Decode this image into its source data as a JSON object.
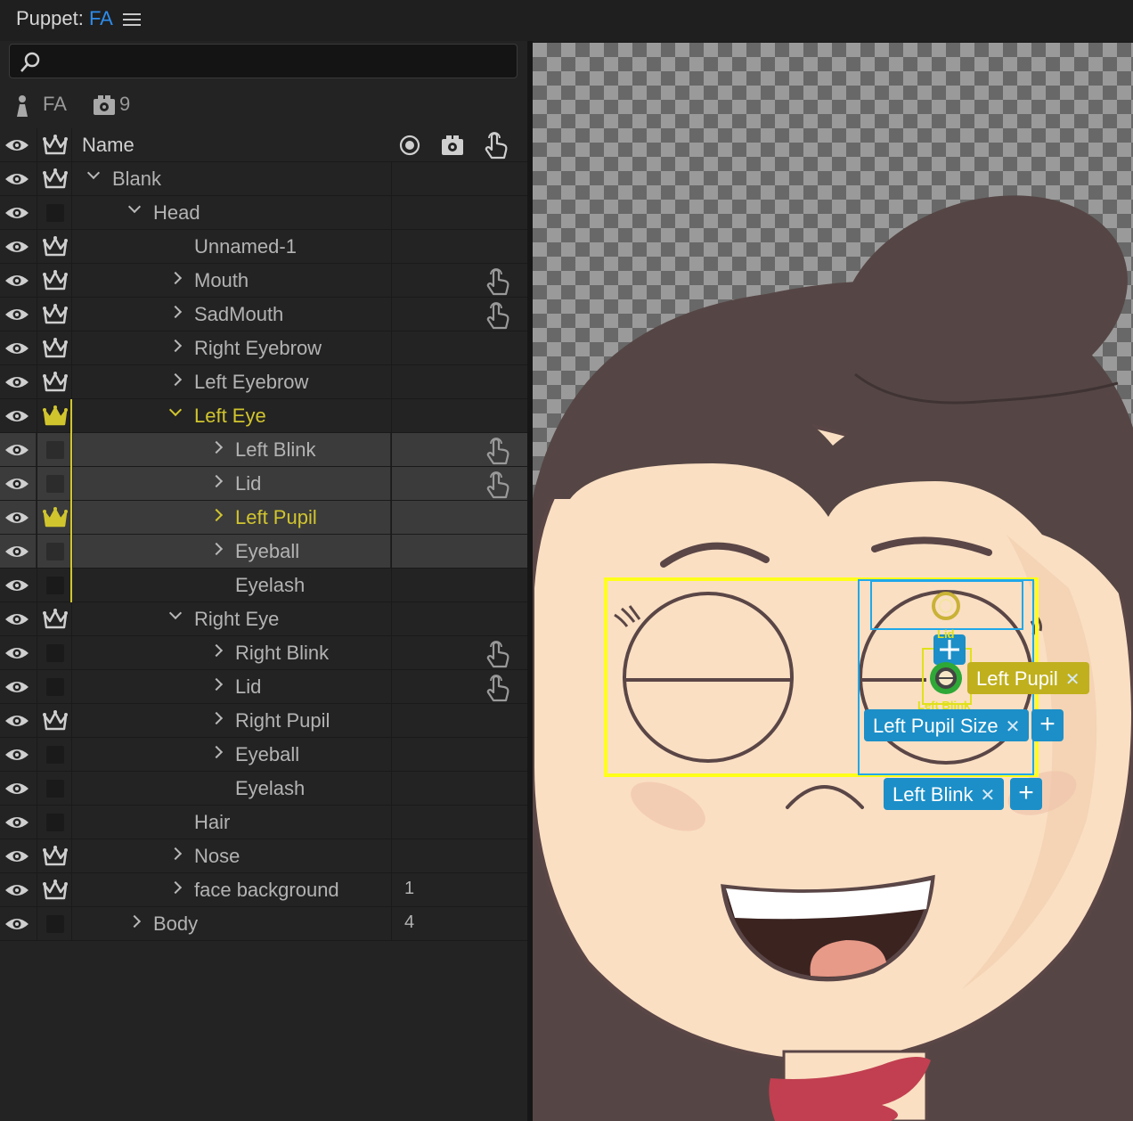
{
  "header": {
    "title_prefix": "Puppet: ",
    "title_accent": "FA",
    "menu_icon": "hamburger-menu-icon"
  },
  "search": {
    "placeholder": "",
    "value": ""
  },
  "puppet_info": {
    "name": "FA",
    "camera_count": "9"
  },
  "table": {
    "column_name": "Name",
    "rows": [
      {
        "label": "Blank",
        "indent": 1,
        "expander": "down",
        "crown": true
      },
      {
        "label": "Head",
        "indent": 2,
        "expander": "down",
        "crown": false
      },
      {
        "label": "Unnamed-1",
        "indent": 3,
        "expander": "none",
        "crown": true
      },
      {
        "label": "Mouth",
        "indent": 3,
        "expander": "right",
        "crown": true,
        "hand": true
      },
      {
        "label": "SadMouth",
        "indent": 3,
        "expander": "right",
        "crown": true,
        "hand": true
      },
      {
        "label": "Right Eyebrow",
        "indent": 3,
        "expander": "right",
        "crown": true
      },
      {
        "label": "Left Eyebrow",
        "indent": 3,
        "expander": "right",
        "crown": true
      },
      {
        "label": "Left Eye",
        "indent": 3,
        "expander": "down",
        "crown": true,
        "highlight": true
      },
      {
        "label": "Left Blink",
        "indent": 4,
        "expander": "right",
        "crown": false,
        "hand": true,
        "selected": true
      },
      {
        "label": "Lid",
        "indent": 4,
        "expander": "right",
        "crown": false,
        "hand": true,
        "selected": true
      },
      {
        "label": "Left Pupil",
        "indent": 4,
        "expander": "right",
        "crown": true,
        "highlight": true,
        "selected": true
      },
      {
        "label": "Eyeball",
        "indent": 4,
        "expander": "right",
        "crown": false,
        "selected": true
      },
      {
        "label": "Eyelash",
        "indent": 4,
        "expander": "none",
        "crown": false
      },
      {
        "label": "Right Eye",
        "indent": 3,
        "expander": "down",
        "crown": true
      },
      {
        "label": "Right Blink",
        "indent": 4,
        "expander": "right",
        "crown": false,
        "hand": true
      },
      {
        "label": "Lid",
        "indent": 4,
        "expander": "right",
        "crown": false,
        "hand": true
      },
      {
        "label": "Right Pupil",
        "indent": 4,
        "expander": "right",
        "crown": true
      },
      {
        "label": "Eyeball",
        "indent": 4,
        "expander": "right",
        "crown": false
      },
      {
        "label": "Eyelash",
        "indent": 4,
        "expander": "none",
        "crown": false
      },
      {
        "label": "Hair",
        "indent": 3,
        "expander": "none",
        "crown": false
      },
      {
        "label": "Nose",
        "indent": 3,
        "expander": "right",
        "crown": true
      },
      {
        "label": "face background",
        "indent": 3,
        "expander": "right",
        "crown": true,
        "number": "1"
      },
      {
        "label": "Body",
        "indent": 2,
        "expander": "right",
        "crown": false,
        "number": "4"
      }
    ]
  },
  "canvas": {
    "lid_label": "Lid",
    "left_blink_label": "Left Blink",
    "tags": {
      "left_pupil": "Left Pupil",
      "left_pupil_size": "Left Pupil Size",
      "left_blink": "Left Blink",
      "remove_glyph": "✕",
      "add_glyph": "+"
    }
  },
  "colors": {
    "accent_blue": "#2d8ceb",
    "highlight_yellow": "#d1c52e",
    "tag_blue": "#1c8fc8",
    "tag_yellow": "#c0b01d",
    "skin": "#fadfc3",
    "hair": "#554645"
  }
}
